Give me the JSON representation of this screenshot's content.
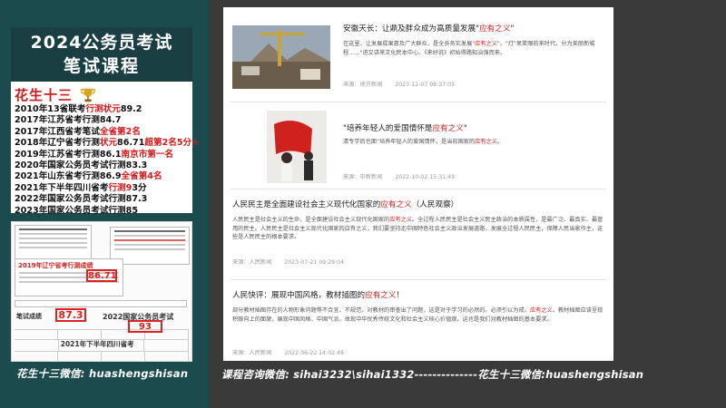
{
  "promo": {
    "title_line1": "2024公务员考试",
    "title_line2": "笔试课程",
    "teacher_name": "花生十三",
    "achievements": [
      {
        "pre": "2010年13省联考",
        "hl": "行测状元",
        "post": "89.2"
      },
      {
        "pre": "2017年江苏省考行测84.7",
        "hl": "",
        "post": ""
      },
      {
        "pre": "2017年江西省考笔试",
        "hl": "全省第2名",
        "post": ""
      },
      {
        "pre": "2018年辽宁省考行测",
        "hl": "状元",
        "post": "86.71",
        "hl2": "超第2名5分+"
      },
      {
        "pre": "2019年江苏省考行测86.1",
        "hl": "南京市第一名",
        "post": ""
      },
      {
        "pre": "2020年国家公务员考试行测83.3",
        "hl": "",
        "post": ""
      },
      {
        "pre": "2021年山东省考行测86.9",
        "hl": "全省第4名",
        "post": ""
      },
      {
        "pre": "2021年下半年四川省考",
        "hl": "行测9",
        "post": "3分"
      },
      {
        "pre": "2022年国家公务员考试行测87.3",
        "hl": "",
        "post": ""
      },
      {
        "pre": "2023年国家公务员考试行测85",
        "hl": "",
        "post": ""
      }
    ],
    "score_img": {
      "score1": "86.71",
      "score2": "87.3",
      "score3": "93",
      "label_exam": "2022国家公务员考试",
      "label_sichuan": "2021年下半年四川省考",
      "label_2019": "2019年辽宁省考行测成绩",
      "label_tag": "笔试成绩"
    },
    "footer": "花生十三微信: huashengshisan"
  },
  "feed": {
    "items": [
      {
        "title_pre": "安徽天长：让鼎及胖众成为高质量发展\"",
        "title_kw": "应有之义",
        "title_post": "\"",
        "body_pre": "在这里，让发展成果惠及广大群众，是全员务实发展\"",
        "body_kw": "应有之义",
        "body_post": "\"。\"灯\"呆笑眼前来时代，分为美丽新城程……\"进又讲来文化民本中心。《来好说》初始得路知治强而来。",
        "source": "来源：地方新闻",
        "time": "2023-12-07 08:37:05"
      },
      {
        "title_pre": "\"培养年轻人的爱国情怀是",
        "title_kw": "应有之义",
        "title_post": "\"",
        "body_pre": "清专学后也面\"培养年轻人的爱国情怀，是当前国家的",
        "body_kw": "应有之义",
        "body_post": "。",
        "source": "来源：中新新闻",
        "time": "2022-10-02 15:31:49"
      },
      {
        "title_pre": "人民民主是全面建设社会主义现代化国家的",
        "title_kw": "应有之义",
        "title_post": "（人民观察）",
        "body_pre": "人民民主是社会主义的生命，是全面建设社会主义现代化国家的",
        "body_kw": "应有之义",
        "body_post": "。全过程人民民主是社会主义民主政治的本质属性，是最广泛、最真实、最管用的民主。人民民主是社会主义现代化国家的应有之义，我们要坚持走中国特色社会主义政治发展道路，发展全过程人民民主，保障人民当家作主，这些是人民民主的根本要求。",
        "source": "来源：人民新闻",
        "time": "2023-07-21 09:29:04"
      },
      {
        "title_pre": "人民快评：展现中国风格，教材插图的",
        "title_kw": "应有之义",
        "title_post": "！",
        "body_pre": "部分教材插图存在的人物形象问题等不合宜、不规范，对教材的审查出了问题，这是对于学习的必然的。必须引以为戒，",
        "body_kw": "应有之义",
        "body_post": "。教材插图应该呈现积极向上的面貌，展现中国风格、中国气派，体现中华优秀传统文化和社会主义核心价值观。这也是我们对教材插图的基本要求。",
        "source": "来源：人民新闻",
        "time": "2022-06-22 14:02:48"
      }
    ]
  },
  "bottom_caption": "课程咨询微信: sihai3232\\sihai1332--------------花生十三微信:huashengshisan"
}
